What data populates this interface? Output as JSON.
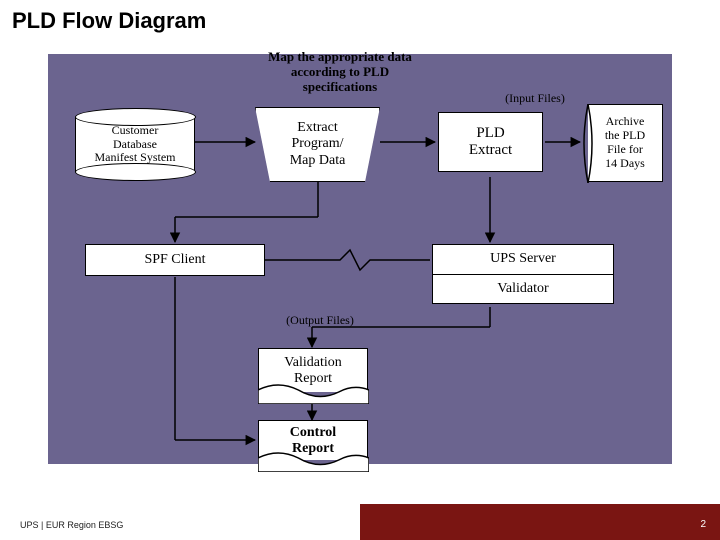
{
  "slide": {
    "title": "PLD Flow Diagram"
  },
  "annotations": {
    "top_caption_l1": "Map the appropriate data",
    "top_caption_l2": "according to PLD",
    "top_caption_l3": "specifications",
    "input_files": "(Input Files)",
    "output_files": "(Output Files)"
  },
  "nodes": {
    "customer_db_l1": "Customer",
    "customer_db_l2": "Database",
    "customer_db_l3": "Manifest System",
    "extract_l1": "Extract",
    "extract_l2": "Program/",
    "extract_l3": "Map Data",
    "pld_extract_l1": "PLD",
    "pld_extract_l2": "Extract",
    "archive_l1": "Archive",
    "archive_l2": "the PLD",
    "archive_l3": "File for",
    "archive_l4": "14 Days",
    "spf_client": "SPF Client",
    "ups_server": "UPS Server",
    "validator": "Validator",
    "validation_l1": "Validation",
    "validation_l2": "Report",
    "control_l1": "Control",
    "control_l2": "Report"
  },
  "footer": {
    "left": "UPS | EUR Region EBSG",
    "page": "2"
  },
  "colors": {
    "diagram_bg": "#6b648f",
    "footer_accent": "#7a1512"
  }
}
